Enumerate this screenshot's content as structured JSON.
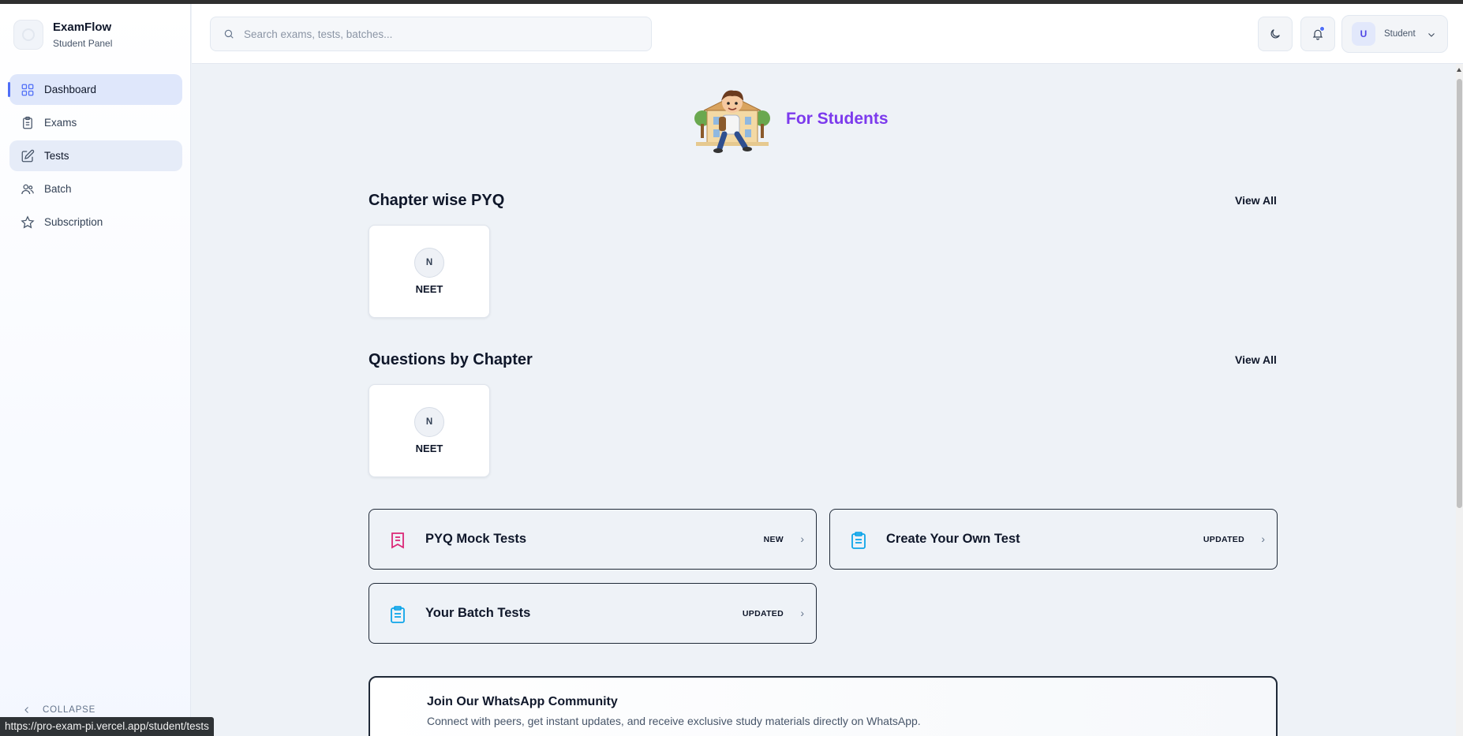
{
  "brand": {
    "name": "ExamFlow",
    "subtitle": "Student Panel"
  },
  "sidebar": {
    "items": [
      {
        "label": "Dashboard",
        "icon": "dashboard-grid-icon"
      },
      {
        "label": "Exams",
        "icon": "clipboard-icon"
      },
      {
        "label": "Tests",
        "icon": "edit-square-icon"
      },
      {
        "label": "Batch",
        "icon": "users-icon"
      },
      {
        "label": "Subscription",
        "icon": "star-icon"
      }
    ],
    "collapse_label": "COLLAPSE"
  },
  "header": {
    "search_placeholder": "Search exams, tests, batches...",
    "user_initial": "U",
    "user_label": "Student"
  },
  "hero": {
    "title": "For Students"
  },
  "sections": {
    "chapter_pyq": {
      "title": "Chapter wise PYQ",
      "view_all": "View All",
      "cards": [
        {
          "initial": "N",
          "name": "NEET"
        }
      ]
    },
    "questions_by_chapter": {
      "title": "Questions by Chapter",
      "view_all": "View All",
      "cards": [
        {
          "initial": "N",
          "name": "NEET"
        }
      ]
    }
  },
  "features": [
    {
      "title": "PYQ Mock Tests",
      "tag": "NEW",
      "icon": "bookmark-list-icon",
      "icon_color": "#db2777"
    },
    {
      "title": "Create Your Own Test",
      "tag": "UPDATED",
      "icon": "clipboard-list-icon",
      "icon_color": "#0ea5e9"
    },
    {
      "title": "Your Batch Tests",
      "tag": "UPDATED",
      "icon": "clipboard-list-icon",
      "icon_color": "#0ea5e9"
    }
  ],
  "whatsapp": {
    "title": "Join Our WhatsApp Community",
    "description": "Connect with peers, get instant updates, and receive exclusive study materials directly on WhatsApp."
  },
  "statusbar": {
    "url": "https://pro-exam-pi.vercel.app/student/tests"
  },
  "colors": {
    "accent": "#4f6ef7",
    "hero_title": "#7c3aed",
    "active_nav_bg": "#dfe7fb"
  }
}
